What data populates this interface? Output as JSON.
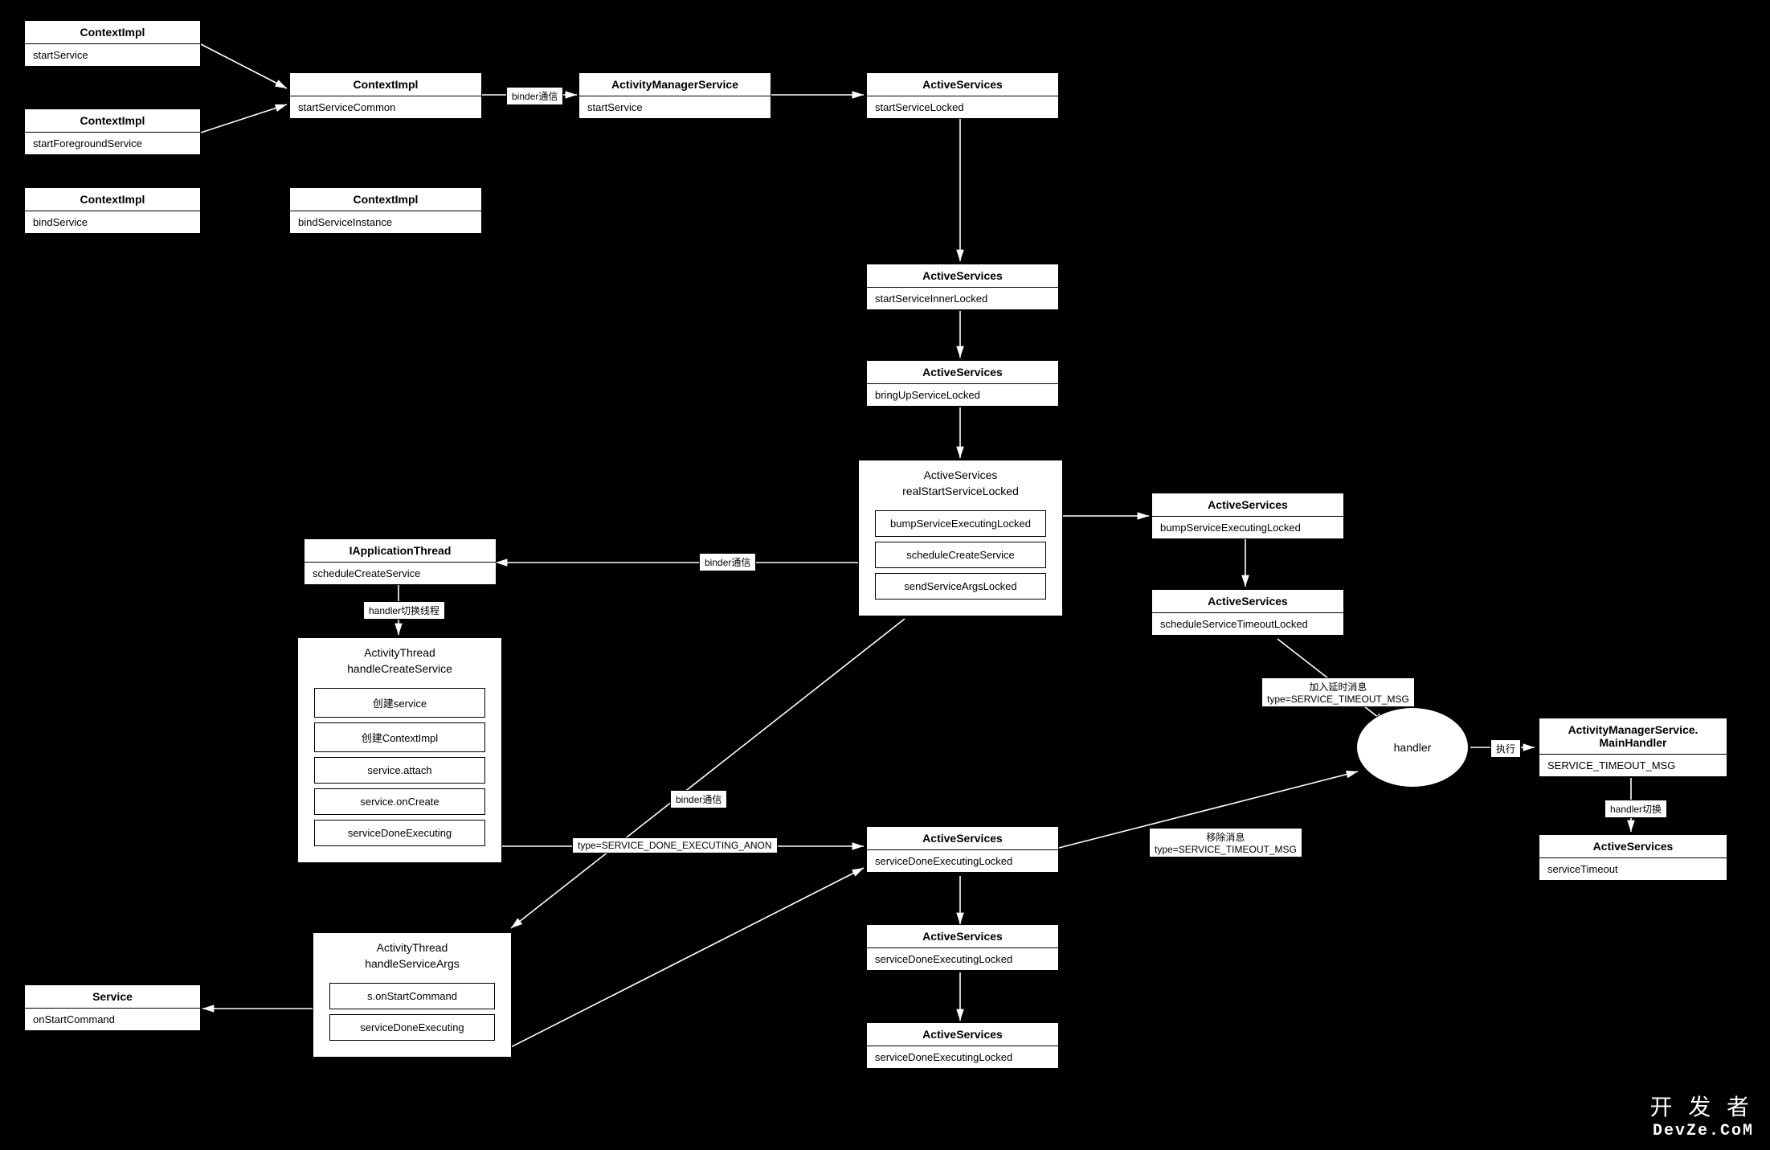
{
  "nodes": {
    "n1": {
      "title": "ContextImpl",
      "method": "startService"
    },
    "n2": {
      "title": "ContextImpl",
      "method": "startForegroundService"
    },
    "n3": {
      "title": "ContextImpl",
      "method": "bindService"
    },
    "n4": {
      "title": "ContextImpl",
      "method": "startServiceCommon"
    },
    "n5": {
      "title": "ContextImpl",
      "method": "bindServiceInstance"
    },
    "n6": {
      "title": "ActivityManagerService",
      "method": "startService"
    },
    "n7": {
      "title": "ActiveServices",
      "method": "startServiceLocked"
    },
    "n8": {
      "title": "ActiveServices",
      "method": "startServiceInnerLocked"
    },
    "n9": {
      "title": "ActiveServices",
      "method": "bringUpServiceLocked"
    },
    "n10": {
      "title": "IApplicationThread",
      "method": "scheduleCreateService"
    },
    "n11": {
      "title": "ActiveServices",
      "method": "bumpServiceExecutingLocked"
    },
    "n12": {
      "title": "ActiveServices",
      "method": "scheduleServiceTimeoutLocked"
    },
    "n13": {
      "title": "ActiveServices",
      "method": "serviceDoneExecutingLocked"
    },
    "n14": {
      "title": "ActiveServices",
      "method": "serviceDoneExecutingLocked"
    },
    "n15": {
      "title": "ActiveServices",
      "method": "serviceDoneExecutingLocked"
    },
    "n16": {
      "title": "ActivityManagerService.\nMainHandler",
      "method": "SERVICE_TIMEOUT_MSG"
    },
    "n17": {
      "title": "ActiveServices",
      "method": "serviceTimeout"
    },
    "n18": {
      "title": "Service",
      "method": "onStartCommand"
    }
  },
  "composites": {
    "c1": {
      "title": "ActiveServices",
      "sub": "realStartServiceLocked",
      "inner": [
        "bumpServiceExecutingLocked",
        "scheduleCreateService",
        "sendServiceArgsLocked"
      ]
    },
    "c2": {
      "title": "ActivityThread",
      "sub": "handleCreateService",
      "inner": [
        "创建service",
        "创建ContextImpl",
        "service.attach",
        "service.onCreate",
        "serviceDoneExecuting"
      ]
    },
    "c3": {
      "title": "ActivityThread",
      "sub": "handleServiceArgs",
      "inner": [
        "s.onStartCommand",
        "serviceDoneExecuting"
      ]
    }
  },
  "ellipse": {
    "label": "handler"
  },
  "edgeLabels": {
    "l1": "binder通信",
    "l2": "binder通信",
    "l3": "handler切换线程",
    "l4": "binder通信",
    "l5": "type=SERVICE_DONE_EXECUTING_ANON",
    "l6": "加入延时消息\ntype=SERVICE_TIMEOUT_MSG",
    "l7": "移除消息\ntype=SERVICE_TIMEOUT_MSG",
    "l8": "执行",
    "l9": "handler切换"
  },
  "watermark": {
    "cn": "开 发 者",
    "en": "DevZe.CoM"
  }
}
